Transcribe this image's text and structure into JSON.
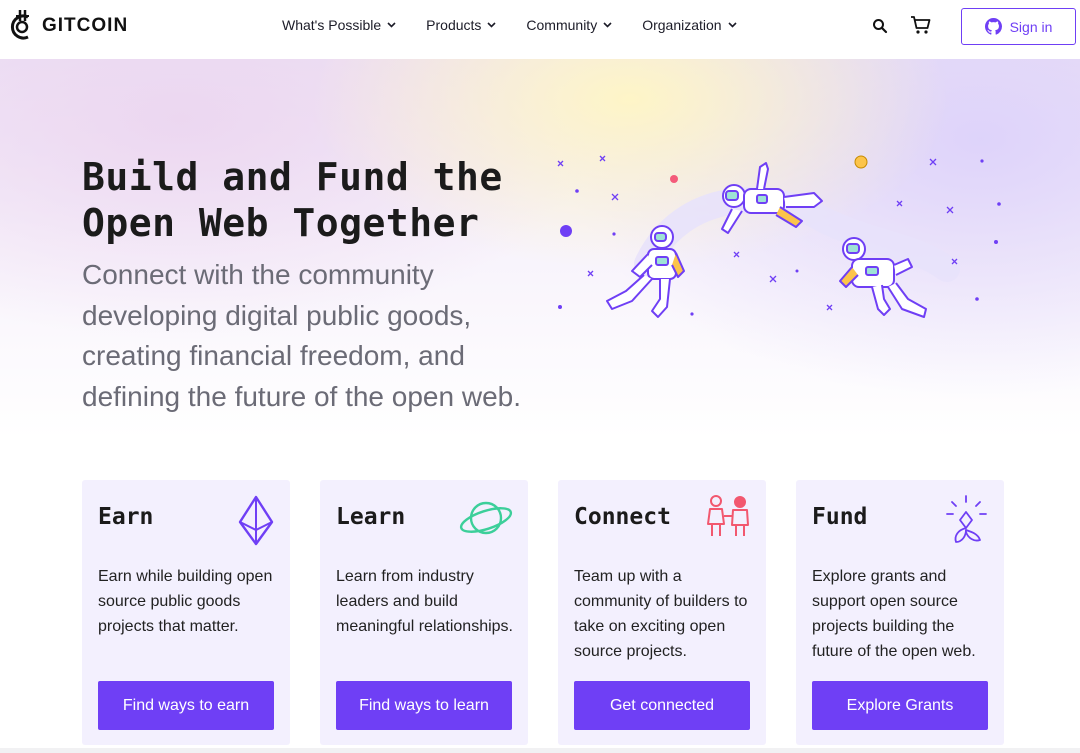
{
  "brand": {
    "name": "GITCOIN"
  },
  "nav": {
    "menu": [
      {
        "label": "What's Possible"
      },
      {
        "label": "Products"
      },
      {
        "label": "Community"
      },
      {
        "label": "Organization"
      }
    ],
    "signin_label": "Sign in"
  },
  "hero": {
    "title": "Build and Fund the Open Web Together",
    "subtitle": "Connect with the community developing digital public goods, creating financial freedom, and defining the future of the open web."
  },
  "cards": [
    {
      "title": "Earn",
      "text": "Earn while building open source public goods projects that matter.",
      "button": "Find ways to earn",
      "icon": "ethereum-icon"
    },
    {
      "title": "Learn",
      "text": "Learn from industry leaders and build meaningful relationships.",
      "button": "Find ways to learn",
      "icon": "planet-icon"
    },
    {
      "title": "Connect",
      "text": "Team up with a community of builders to take on exciting open source projects.",
      "button": "Get connected",
      "icon": "people-icon"
    },
    {
      "title": "Fund",
      "text": "Explore grants and support open source projects building the future of the open web.",
      "button": "Explore Grants",
      "icon": "sprout-icon"
    }
  ],
  "colors": {
    "accent": "#6f3ff5",
    "card_bg": "#f3f0fe",
    "hero_text": "#1b1b1b",
    "subtitle_text": "#6b6b76"
  }
}
